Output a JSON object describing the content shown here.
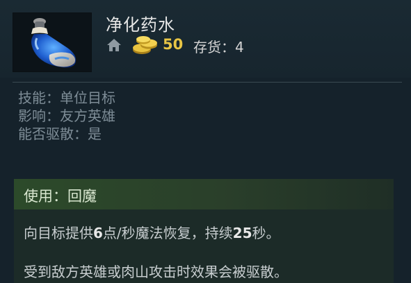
{
  "item": {
    "icon": "blue-potion-icon",
    "name": "净化药水",
    "cost": "50",
    "stock_label": "存货：",
    "stock_value": "4"
  },
  "attributes": [
    "技能：单位目标",
    "影响：友方英雄",
    "能否驱散：是"
  ],
  "ability": {
    "header": "使用：回魔",
    "desc_pre": "向目标提供",
    "desc_num1": "6",
    "desc_mid": "点/秒魔法恢复，持续",
    "desc_num2": "25",
    "desc_post": "秒。",
    "note": "受到敌方英雄或肉山攻击时效果会被驱散。"
  },
  "colors": {
    "gold": "#e8c545",
    "ability_header": "#2c4a2a",
    "background": "#15222b"
  }
}
